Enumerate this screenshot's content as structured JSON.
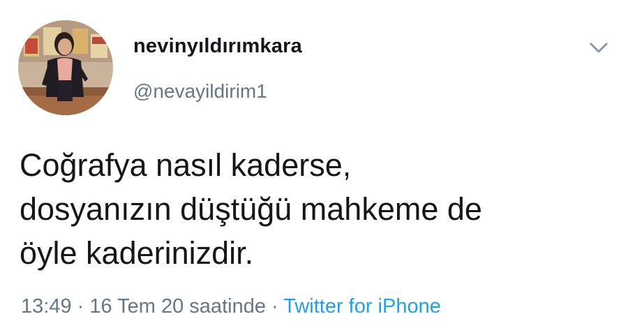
{
  "user": {
    "display_name": "nevinyıldırımkara",
    "handle": "@nevayildirim1"
  },
  "tweet": {
    "lines": [
      "Coğrafya nasıl kaderse,",
      "dosyanızın düştüğü mahkeme de",
      "öyle kaderinizdir."
    ]
  },
  "meta": {
    "time": "13:49",
    "sep1": " · ",
    "date": "16 Tem 20 saatinde",
    "sep2": " · ",
    "source": "Twitter for iPhone"
  },
  "icons": {
    "menu": "chevron-down-icon",
    "avatar": "avatar"
  },
  "colors": {
    "text": "#14171a",
    "secondary": "#657786",
    "link": "#1da1f2",
    "background": "#ffffff"
  }
}
